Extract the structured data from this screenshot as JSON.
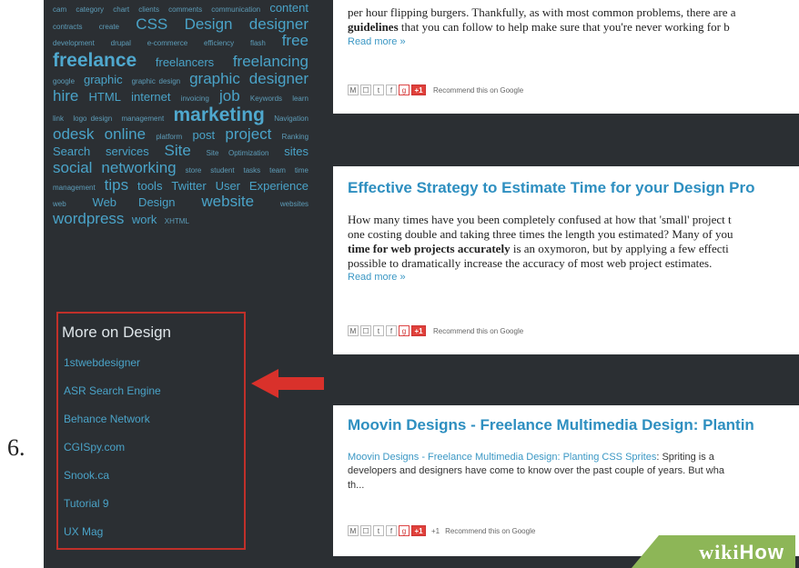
{
  "step_number": "6.",
  "tag_cloud": [
    {
      "text": "cam",
      "size": 1
    },
    {
      "text": "category",
      "size": 1
    },
    {
      "text": "chart",
      "size": 1
    },
    {
      "text": "clients",
      "size": 1
    },
    {
      "text": "comments",
      "size": 1
    },
    {
      "text": "communication",
      "size": 1
    },
    {
      "text": "content",
      "size": 2
    },
    {
      "text": "contracts",
      "size": 1
    },
    {
      "text": "create",
      "size": 1
    },
    {
      "text": "CSS",
      "size": 3
    },
    {
      "text": "Design",
      "size": 3
    },
    {
      "text": "designer",
      "size": 3
    },
    {
      "text": "development",
      "size": 1
    },
    {
      "text": "drupal",
      "size": 1
    },
    {
      "text": "e-commerce",
      "size": 1
    },
    {
      "text": "efficiency",
      "size": 1
    },
    {
      "text": "flash",
      "size": 1
    },
    {
      "text": "free",
      "size": 3
    },
    {
      "text": "freelance",
      "size": 4
    },
    {
      "text": "freelancers",
      "size": 2
    },
    {
      "text": "freelancing",
      "size": 3
    },
    {
      "text": "google",
      "size": 1
    },
    {
      "text": "graphic",
      "size": 2
    },
    {
      "text": "graphic design",
      "size": 1
    },
    {
      "text": "graphic",
      "size": 3
    },
    {
      "text": "designer",
      "size": 3
    },
    {
      "text": "hire",
      "size": 3
    },
    {
      "text": "HTML",
      "size": 2
    },
    {
      "text": "internet",
      "size": 2
    },
    {
      "text": "invoicing",
      "size": 1
    },
    {
      "text": "job",
      "size": 3
    },
    {
      "text": "Keywords",
      "size": 1
    },
    {
      "text": "learn",
      "size": 1
    },
    {
      "text": "link",
      "size": 1
    },
    {
      "text": "logo design",
      "size": 1
    },
    {
      "text": "management",
      "size": 1
    },
    {
      "text": "marketing",
      "size": 4
    },
    {
      "text": "Navigation",
      "size": 1
    },
    {
      "text": "odesk",
      "size": 3
    },
    {
      "text": "online",
      "size": 3
    },
    {
      "text": "platform",
      "size": 1
    },
    {
      "text": "post",
      "size": 2
    },
    {
      "text": "project",
      "size": 3
    },
    {
      "text": "Ranking",
      "size": 1
    },
    {
      "text": "Search",
      "size": 2
    },
    {
      "text": "services",
      "size": 2
    },
    {
      "text": "Site",
      "size": 3
    },
    {
      "text": "Site Optimization",
      "size": 1
    },
    {
      "text": "sites",
      "size": 2
    },
    {
      "text": "social",
      "size": 3
    },
    {
      "text": "networking",
      "size": 3
    },
    {
      "text": "store",
      "size": 1
    },
    {
      "text": "student",
      "size": 1
    },
    {
      "text": "tasks",
      "size": 1
    },
    {
      "text": "team",
      "size": 1
    },
    {
      "text": "time",
      "size": 1
    },
    {
      "text": "management",
      "size": 1
    },
    {
      "text": "tips",
      "size": 3
    },
    {
      "text": "tools",
      "size": 2
    },
    {
      "text": "Twitter",
      "size": 2
    },
    {
      "text": "User",
      "size": 2
    },
    {
      "text": "Experience",
      "size": 2
    },
    {
      "text": "web",
      "size": 1
    },
    {
      "text": "Web Design",
      "size": 2
    },
    {
      "text": "website",
      "size": 3
    },
    {
      "text": "websites",
      "size": 1
    },
    {
      "text": "wordpress",
      "size": 3
    },
    {
      "text": "work",
      "size": 2
    },
    {
      "text": "XHTML",
      "size": 1
    }
  ],
  "more_on_design": {
    "title": "More on Design",
    "links": [
      "1stwebdesigner",
      "ASR Search Engine",
      "Behance Network",
      "CGISpy.com",
      "Snook.ca",
      "Tutorial 9",
      "UX Mag"
    ]
  },
  "posts": [
    {
      "title": "",
      "lines": [
        {
          "pre": "per hour flipping burgers. Thankfully, as with most common problems, there are a",
          "bold": "",
          "post": ""
        },
        {
          "pre": "",
          "bold": "guidelines",
          "post": " that you can follow to help make sure that you're never working for b"
        }
      ],
      "read_more": "Read more »",
      "plus_count": "",
      "recommend": "Recommend this on Google"
    },
    {
      "title": "Effective Strategy to Estimate Time for your Design Pro",
      "lines": [
        {
          "pre": "How many times have you been completely confused at how that 'small' project t",
          "bold": "",
          "post": ""
        },
        {
          "pre": "one costing double and taking three times the length you estimated? Many of you",
          "bold": "",
          "post": ""
        },
        {
          "pre": "",
          "bold": "time for web projects accurately",
          "post": " is an oxymoron, but by applying a few effecti"
        },
        {
          "pre": "possible to dramatically increase the accuracy of most web project estimates.",
          "bold": "",
          "post": ""
        }
      ],
      "read_more": "Read more »",
      "plus_count": "",
      "recommend": "Recommend this on Google"
    },
    {
      "title": "Moovin Designs - Freelance Multimedia Design: Plantin",
      "link_text": "Moovin Designs - Freelance Multimedia Design: Planting CSS Sprites",
      "lines": [
        {
          "pre": ": Spriting is a ",
          "bold": "",
          "post": ""
        },
        {
          "pre": "developers and designers have come to know over the past couple of years. But wha",
          "bold": "",
          "post": ""
        },
        {
          "pre": "th...",
          "bold": "",
          "post": ""
        }
      ],
      "read_more": "",
      "plus_count": "+1",
      "recommend": "Recommend this on Google"
    }
  ],
  "share_buttons": [
    "M",
    "☐",
    "t",
    "f",
    "g",
    "+1"
  ],
  "watermark": {
    "wiki": "wiki",
    "how": "How"
  },
  "colors": {
    "background": "#2b2f33",
    "link": "#4aa3c8",
    "title": "#2e8fc0",
    "highlight_box": "#c0302a",
    "arrow": "#d9312b"
  }
}
